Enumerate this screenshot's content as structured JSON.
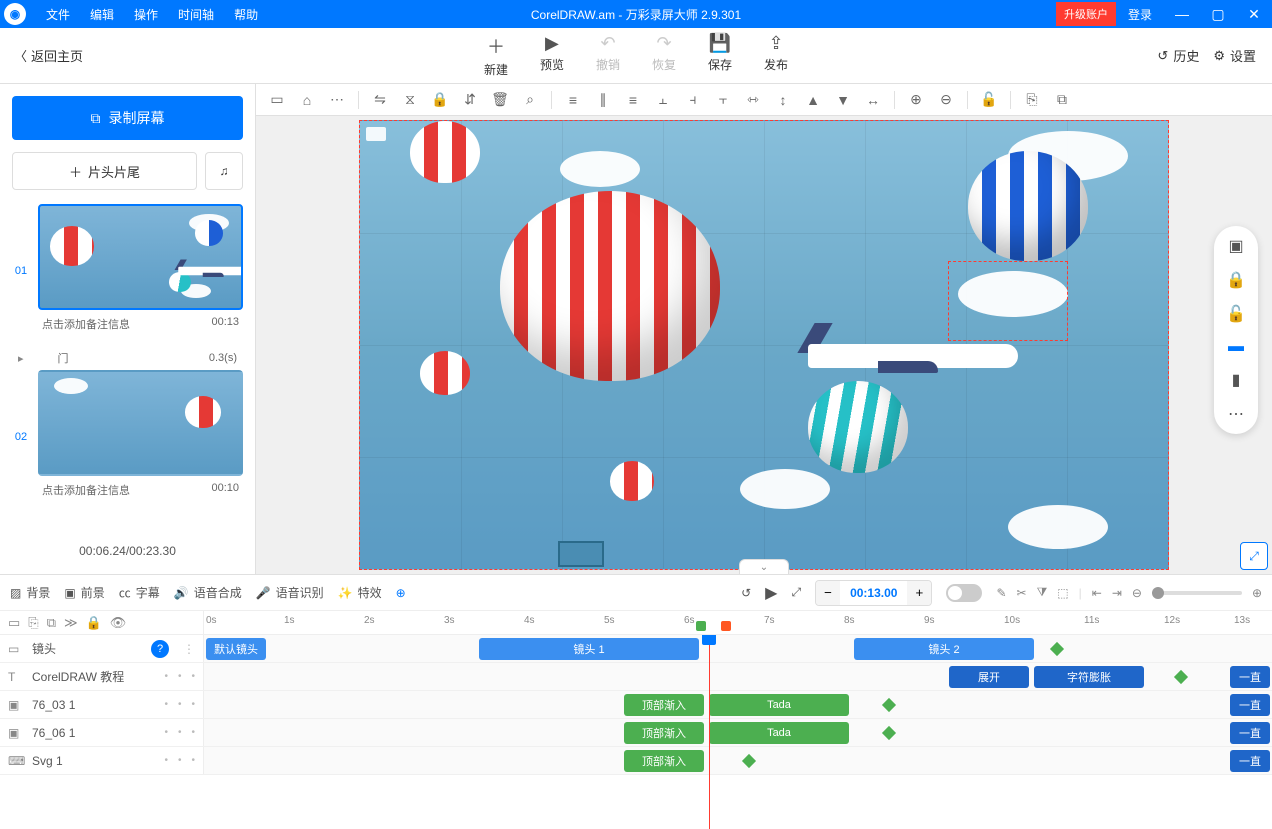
{
  "titlebar": {
    "menus": [
      "文件",
      "编辑",
      "操作",
      "时间轴",
      "帮助"
    ],
    "title": "CorelDRAW.am - 万彩录屏大师 2.9.301",
    "upgrade": "升级账户",
    "login": "登录"
  },
  "toolbar": {
    "back": "返回主页",
    "items": [
      {
        "icon": "＋",
        "label": "新建"
      },
      {
        "icon": "▶",
        "label": "预览"
      },
      {
        "icon": "↶",
        "label": "撤销",
        "disabled": true
      },
      {
        "icon": "↷",
        "label": "恢复",
        "disabled": true
      },
      {
        "icon": "💾",
        "label": "保存"
      },
      {
        "icon": "⇪",
        "label": "发布"
      }
    ],
    "history": "历史",
    "settings": "设置"
  },
  "leftpane": {
    "record": "录制屏幕",
    "headtail": "片头片尾",
    "scenes": [
      {
        "num": "01",
        "note": "点击添加备注信息",
        "dur": "00:13",
        "selected": true,
        "trans": "门",
        "transDur": "0.3(s)"
      },
      {
        "num": "02",
        "note": "点击添加备注信息",
        "dur": "00:10"
      }
    ],
    "overallTime": "00:06.24/00:23.30"
  },
  "canvas": {
    "collapse": "⌄"
  },
  "timeline": {
    "tabs": [
      {
        "icon": "▨",
        "label": "背景"
      },
      {
        "icon": "▣",
        "label": "前景"
      },
      {
        "icon": "㏄",
        "label": "字幕"
      },
      {
        "icon": "🔊",
        "label": "语音合成"
      },
      {
        "icon": "🎤",
        "label": "语音识别"
      },
      {
        "icon": "✨",
        "label": "特效"
      }
    ],
    "timeValue": "00:13.00",
    "ticks": [
      "0s",
      "1s",
      "2s",
      "3s",
      "4s",
      "5s",
      "6s",
      "7s",
      "8s",
      "9s",
      "10s",
      "11s",
      "12s",
      "13s"
    ],
    "tracks": [
      {
        "icon": "▭",
        "name": "镜头",
        "help": true
      },
      {
        "icon": "T",
        "name": "CorelDRAW 教程"
      },
      {
        "icon": "▣",
        "name": "76_03 1"
      },
      {
        "icon": "▣",
        "name": "76_06 1"
      },
      {
        "icon": "⌨",
        "name": "Svg 1"
      }
    ],
    "shots": [
      "默认镜头",
      "镜头 1",
      "镜头 2"
    ],
    "effects": {
      "expand": "展开",
      "char": "字符膨胀",
      "topin": "顶部渐入",
      "tada": "Tada",
      "always": "一直"
    }
  }
}
